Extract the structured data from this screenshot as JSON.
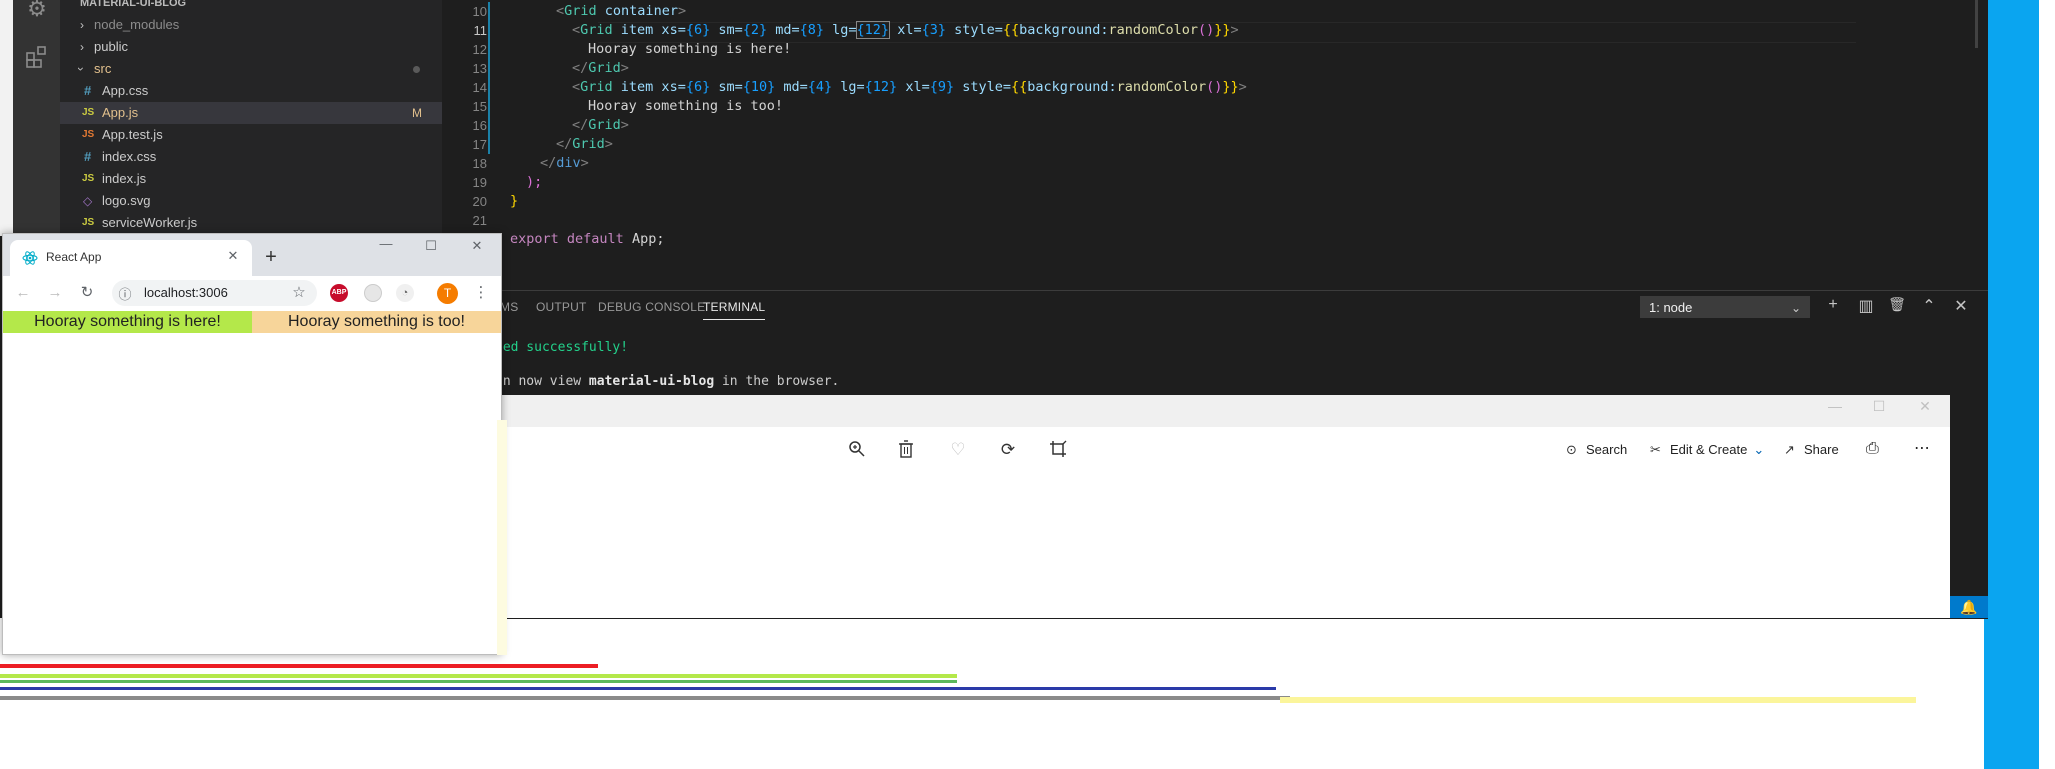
{
  "explorer": {
    "project_name": "MATERIAL-UI-BLOG",
    "items": [
      {
        "label": "node_modules",
        "type": "folder",
        "expanded": false
      },
      {
        "label": "public",
        "type": "folder",
        "expanded": false
      },
      {
        "label": "src",
        "type": "folder",
        "expanded": true
      },
      {
        "label": "App.css",
        "type": "css",
        "icon": "#"
      },
      {
        "label": "App.js",
        "type": "js",
        "icon": "JS",
        "badge": "M"
      },
      {
        "label": "App.test.js",
        "type": "js",
        "icon": "JS"
      },
      {
        "label": "index.css",
        "type": "css",
        "icon": "#"
      },
      {
        "label": "index.js",
        "type": "js",
        "icon": "JS"
      },
      {
        "label": "logo.svg",
        "type": "svg",
        "icon": "◇"
      },
      {
        "label": "serviceWorker.js",
        "type": "js",
        "icon": "JS"
      }
    ]
  },
  "editor": {
    "line_numbers": [
      "10",
      "11",
      "12",
      "13",
      "14",
      "15",
      "16",
      "17",
      "18",
      "19",
      "20",
      "21"
    ],
    "lines": {
      "l10_tag": "Grid",
      "l10_attr": "container",
      "l11_tag": "Grid",
      "l11_attrs": "item xs=",
      "l11_v1": "{6}",
      "l11_a2": " sm=",
      "l11_v2": "{2}",
      "l11_a3": " md=",
      "l11_v3": "{8}",
      "l11_a4": " lg=",
      "l11_v4": "{12}",
      "l11_a5": " xl=",
      "l11_v5": "{3}",
      "l11_a6": " style=",
      "l11_v6a": "{{",
      "l11_v6b": "background:",
      "l11_v6c": "randomColor",
      "l11_v6d": "()",
      "l11_v6e": "}}",
      "l12_text": "Hooray something is here!",
      "l13_tag": "Grid",
      "l14_tag": "Grid",
      "l14_attrs": "item xs=",
      "l14_v1": "{6}",
      "l14_a2": " sm=",
      "l14_v2": "{10}",
      "l14_a3": " md=",
      "l14_v3": "{4}",
      "l14_a4": " lg=",
      "l14_v4": "{12}",
      "l14_a5": " xl=",
      "l14_v5": "{9}",
      "l14_a6": " style=",
      "l15_text": "Hooray something is too!",
      "l16_tag": "Grid",
      "l17_tag": "Grid",
      "l18_tag": "div",
      "l19_text": ");",
      "l20_text": "}",
      "l22_kw": "export default",
      "l22_name": "App;"
    }
  },
  "panel": {
    "tabs": [
      "MS",
      "OUTPUT",
      "DEBUG CONSOLE",
      "TERMINAL"
    ],
    "active_tab": "TERMINAL",
    "terminal_select": "1: node",
    "terminal_lines": {
      "compiled": "led successfully!",
      "view_pre": "an now view ",
      "view_bold": "material-ui-blog",
      "view_post": " in the browser."
    }
  },
  "photos": {
    "search": "Search",
    "edit_create": "Edit & Create",
    "share": "Share"
  },
  "chrome": {
    "tab_title": "React App",
    "url": "localhost:3006",
    "abp_label": "ABP",
    "avatar_initial": "T",
    "grid_left_text": "Hooray something is here!",
    "grid_right_text": "Hooray something is too!",
    "colors": {
      "grid_left": "#b4e84a",
      "grid_right": "#f7d59a"
    }
  },
  "status": {
    "bell": "🔔"
  }
}
